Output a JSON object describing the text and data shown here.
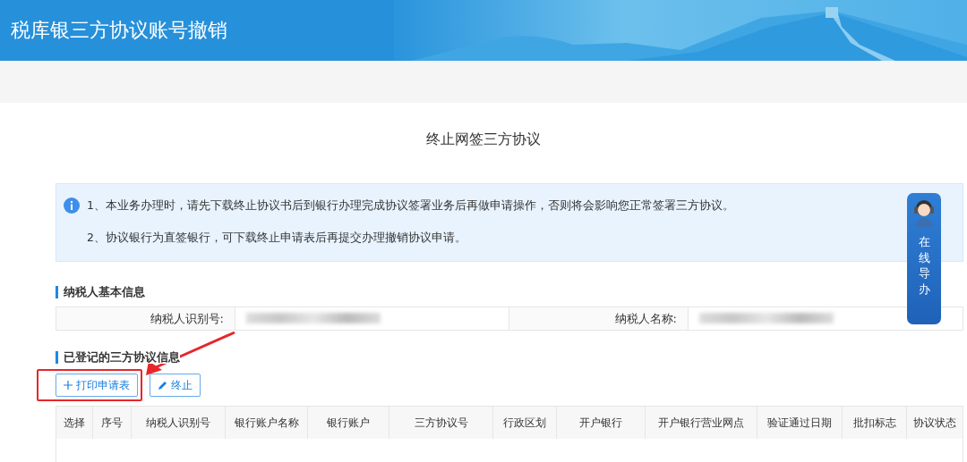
{
  "header": {
    "title": "税库银三方协议账号撤销"
  },
  "page_title": "终止网签三方协议",
  "notice": {
    "lines": [
      "1、本业务办理时，请先下载终止协议书后到银行办理完成协议签署业务后再做申请操作，否则将会影响您正常签署三方协议。",
      "2、协议银行为直签银行，可下载终止申请表后再提交办理撤销协议申请。"
    ]
  },
  "guide_widget": {
    "label": "在线导办"
  },
  "taxpayer_section": {
    "heading": "纳税人基本信息",
    "fields": [
      {
        "label": "纳税人识别号:"
      },
      {
        "label": "纳税人名称:"
      }
    ]
  },
  "agreement_section": {
    "heading": "已登记的三方协议信息",
    "buttons": [
      {
        "label": "打印申请表",
        "highlighted": true
      },
      {
        "label": "终止",
        "highlighted": false
      }
    ],
    "table": {
      "columns": [
        "选择",
        "序号",
        "纳税人识别号",
        "银行账户名称",
        "银行账户",
        "三方协议号",
        "行政区划",
        "开户银行",
        "开户银行营业网点",
        "验证通过日期",
        "批扣标志",
        "协议状态"
      ]
    }
  }
}
